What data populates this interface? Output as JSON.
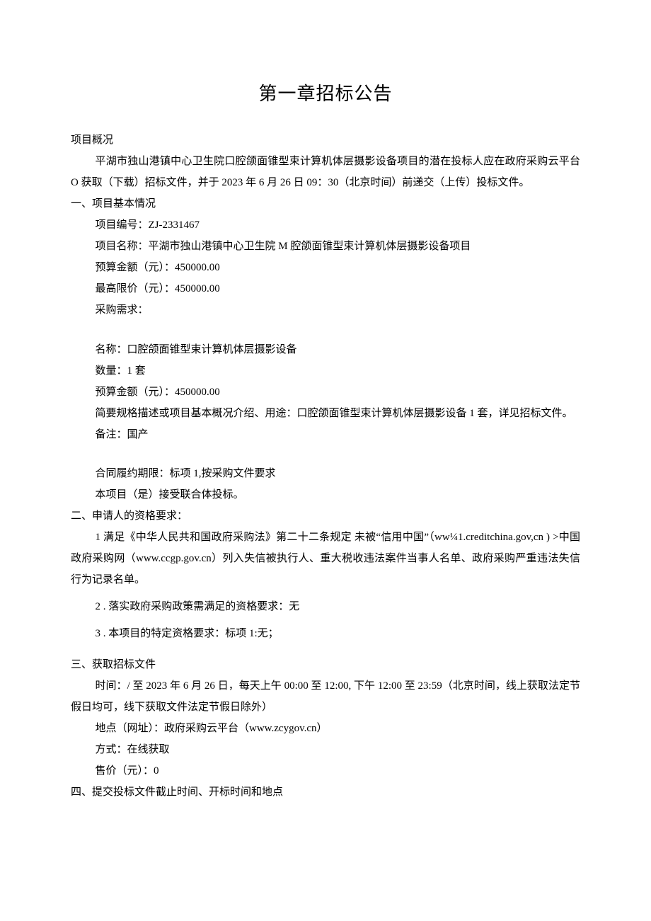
{
  "title": "第一章招标公告",
  "overview_heading": "项目概况",
  "overview_para": "平湖市独山港镇中心卫生院口腔颌面锥型束计算机体层摄影设备项目的潜在投标人应在政府采购云平台 O 获取（下载）招标文件，并于 2023 年 6 月 26 日 09：30（北京时间）前递交（上传）投标文件。",
  "sec1": {
    "heading": "一、项目基本情况",
    "project_no": "项目编号：ZJ-2331467",
    "project_name": "项目名称：平湖市独山港镇中心卫生院 M 腔颌面锥型束计算机体层摄影设备项目",
    "budget": "预算金额（元）：450000.00",
    "ceiling": "最高限价（元）：450000.00",
    "need_label": "采购需求：",
    "item_name": "名称：口腔颌面锥型束计算机体层摄影设备",
    "item_qty": "数量：1 套",
    "item_budget": "预算金额（元）：450000.00",
    "item_brief": "简要规格描述或项目基本概况介绍、用途：口腔颌面锥型束计算机体层摄影设备 1 套，详见招标文件。",
    "item_remark": "备注：国产",
    "contract": "合同履约期限：标项 1,按采购文件要求",
    "joint": "本项目（是）接受联合体投标。"
  },
  "sec2": {
    "heading": "二、申请人的资格要求：",
    "q1": "1 满足《中华人民共和国政府采购法》第二十二条规定 未被“信用中国”（ww¼1.creditchina.gov,cn\n) >中国政府采购网（www.ccgp.gov.cn）列入失信被执行人、重大税收违法案件当事人名单、政府采购严重违法失信行为记录名单。",
    "q2": "2 . 落实政府采购政策需满足的资格要求：无",
    "q3": "3 . 本项目的特定资格要求：标项 1:无；"
  },
  "sec3": {
    "heading": "三、获取招标文件",
    "time": "时间：/ 至 2023 年 6 月 26 日，每天上午 00:00 至 12:00, 下午 12:00 至 23:59（北京时间，线上获取法定节假日均可，线下获取文件法定节假日除外）",
    "place": "地点（网址）：政府采购云平台（www.zcygov.cn）",
    "method": "方式：在线获取",
    "price": "售价（元）：0"
  },
  "sec4": {
    "heading": "四、提交投标文件截止时间、开标时间和地点"
  }
}
